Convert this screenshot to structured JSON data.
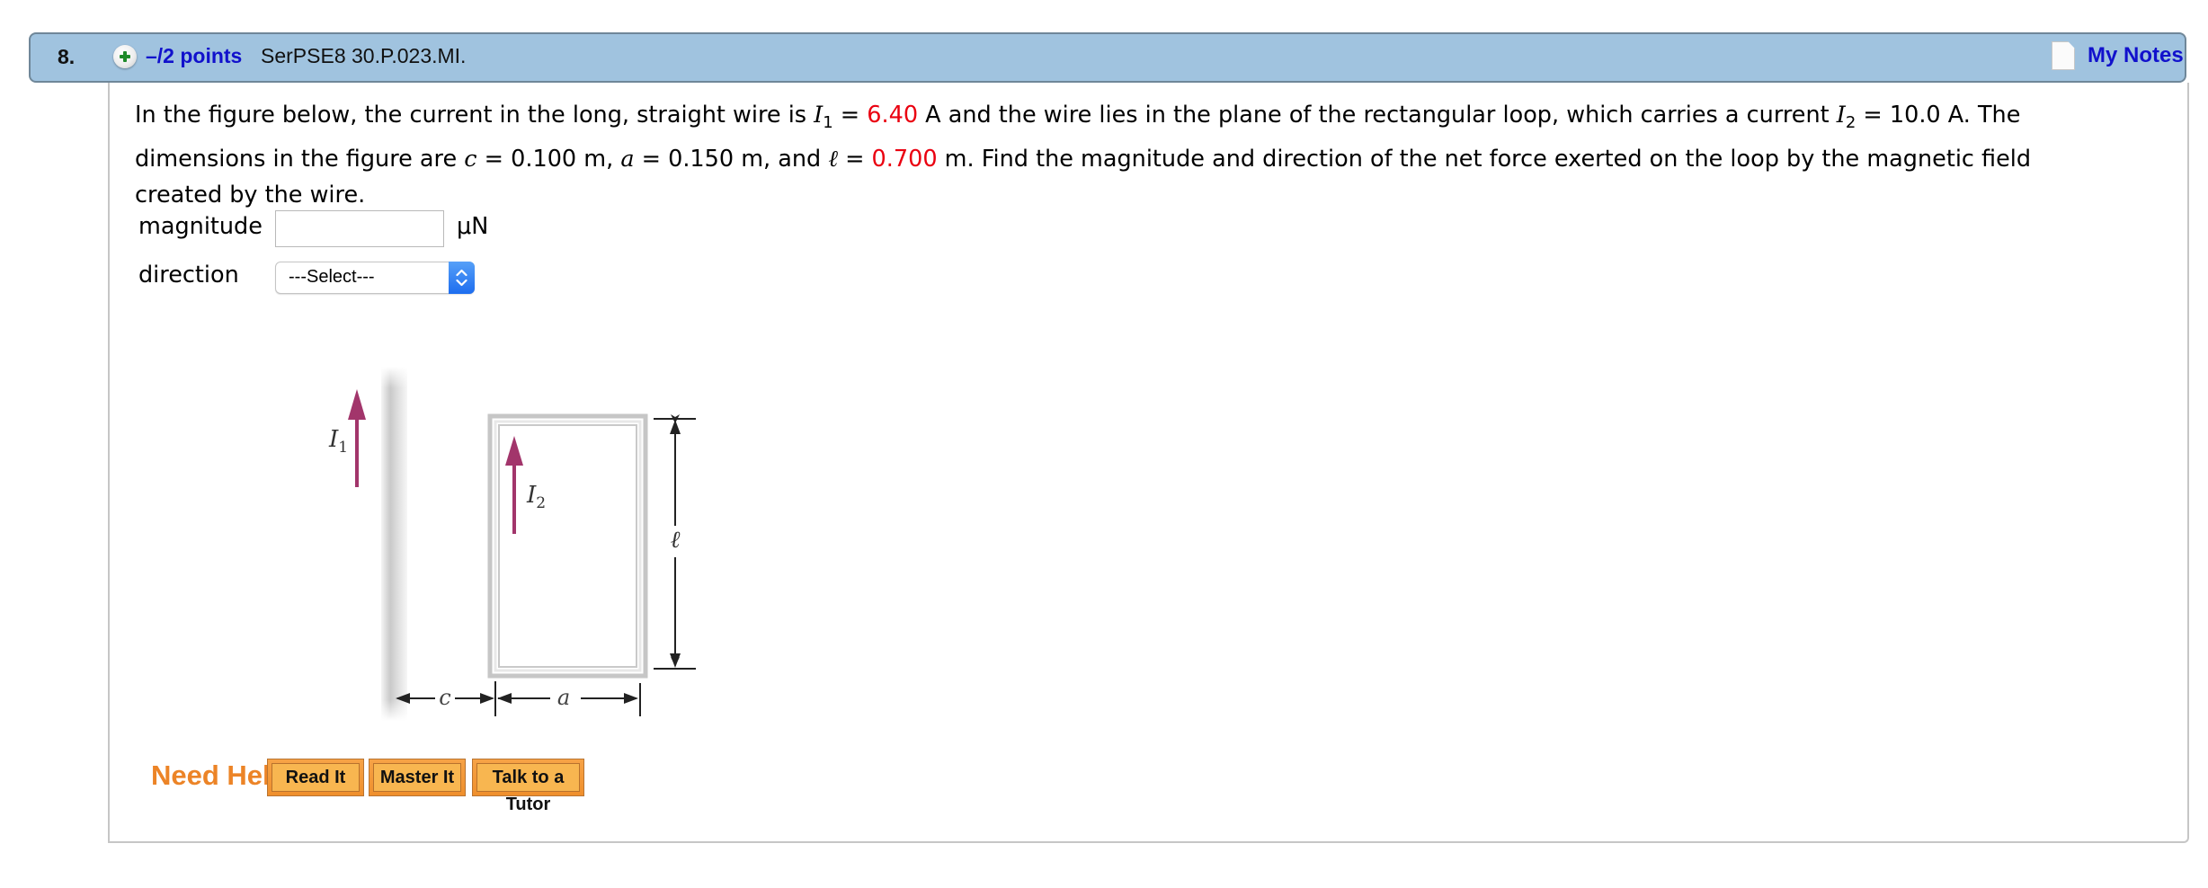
{
  "header": {
    "question_number": "8.",
    "points": "–/2 points",
    "question_id": "SerPSE8 30.P.023.MI.",
    "my_notes": "My Notes"
  },
  "prompt": {
    "line1_a": "In the figure below, the current in the long, straight wire is ",
    "I1_symbol": "I",
    "I1_sub": "1",
    "eq1": " = ",
    "I1_value": "6.40",
    "line1_b": " A  and the wire lies in the plane of the rectangular loop, which carries a current ",
    "I2_symbol": "I",
    "I2_sub": "2",
    "I2_rest": " = 10.0 A.  The",
    "line2_a": "dimensions in the figure are ",
    "c_symbol": "c",
    "c_rest": " = 0.100 m,  ",
    "a_symbol": "a",
    "a_rest": " = 0.150 m,  and ",
    "l_symbol": "ℓ",
    "eq2": " = ",
    "l_value": "0.700",
    "line2_b": " m.  Find the magnitude and direction of the net force exerted on the loop by the magnetic field",
    "line3": "created by the wire."
  },
  "answers": {
    "magnitude_label": "magnitude",
    "magnitude_value": "",
    "magnitude_unit": "μN",
    "direction_label": "direction",
    "direction_selected": "---Select---"
  },
  "figure": {
    "I1_label": "I",
    "I1_sub": "1",
    "I2_label": "I",
    "I2_sub": "2",
    "l_label": "ℓ",
    "c_label": "c",
    "a_label": "a",
    "arrow_color": "#a2356b"
  },
  "help": {
    "label": "Need Help?",
    "buttons": [
      "Read It",
      "Master It",
      "Talk to a Tutor"
    ]
  },
  "colors": {
    "header_bg": "#a0c3df",
    "link_blue": "#1111cc",
    "value_red": "#ea0010",
    "help_orange": "#ec8427"
  }
}
